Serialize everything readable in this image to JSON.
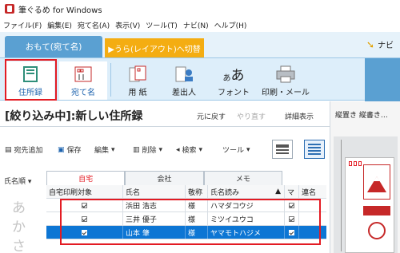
{
  "window": {
    "title": "筆ぐるめ for Windows"
  },
  "menu": [
    "ファイル(F)",
    "編集(E)",
    "宛て名(A)",
    "表示(V)",
    "ツール(T)",
    "ナビ(N)",
    "ヘルプ(H)"
  ],
  "mode_tabs": {
    "omote": "おもて(宛て名)",
    "ura": "▶うら(レイアウト)へ切替",
    "navi": "ナビ"
  },
  "ribbon": {
    "address_book": "住所録",
    "atena": "宛て名",
    "paper": "用 紙",
    "sender": "差出人",
    "font": "フォント",
    "print_mail": "印刷・メール",
    "font_icon_text": "あ",
    "font_icon_text_big": "あ"
  },
  "header": {
    "title": "[絞り込み中]:新しい住所録",
    "undo": "元に戻す",
    "redo": "やり直す",
    "detail": "詳細表示"
  },
  "toolbar": {
    "add": "宛先追加",
    "save": "保存",
    "edit": "編集",
    "delete": "削除",
    "search": "検索",
    "tools": "ツール",
    "save_glyph": "▣",
    "delete_glyph": "▥",
    "dropdown_glyph": "▾",
    "add_glyph": "▤",
    "search_glyph": "◂"
  },
  "left": {
    "sort": "氏名順",
    "sort_arrow": "▾",
    "kana": [
      "あ",
      "か",
      "さ"
    ]
  },
  "list_tabs": [
    "自宅",
    "会社",
    "メモ"
  ],
  "table": {
    "headers": [
      "自宅印刷対象",
      "氏名",
      "敬称",
      "氏名読み",
      "マ",
      "連名"
    ],
    "sort_indicator": "▲",
    "rows": [
      {
        "name": "浜田 浩志",
        "honorific": "様",
        "reading": "ハマダコウジ"
      },
      {
        "name": "三井 優子",
        "honorific": "様",
        "reading": "ミツイユウコ"
      },
      {
        "name": "山本 肇",
        "honorific": "様",
        "reading": "ヤマモトハジメ"
      }
    ]
  },
  "right_pane": {
    "tab": "縦置き 縦書き…"
  },
  "colors": {
    "accent_blue": "#5aa0d2",
    "ura_orange": "#f4ad12",
    "highlight_red": "#e31b23",
    "selected_row": "#0d76d4"
  }
}
